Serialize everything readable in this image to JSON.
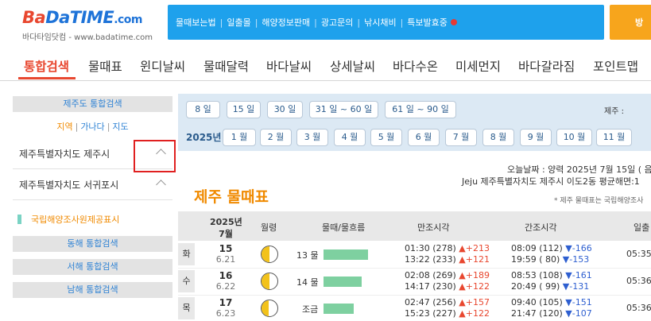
{
  "header": {
    "logo_b": "Ba",
    "logo_d": "Da",
    "logo_time": "TIME",
    "logo_com": ".com",
    "logo_sub": "바다타임닷컴 - www.badatime.com",
    "links": [
      "물때보는법",
      "일출몰",
      "해양정보판매",
      "광고문의",
      "낚시채비",
      "특보발효중"
    ],
    "right_btn": "방",
    "colors": {
      "topbar": "#1ea1ec",
      "accent": "#e8472f",
      "orange": "#f08a00"
    }
  },
  "nav": {
    "items": [
      "통합검색",
      "물때표",
      "윈디날씨",
      "물때달력",
      "바다날씨",
      "상세날씨",
      "바다수온",
      "미세먼지",
      "바다갈라짐",
      "포인트맵"
    ],
    "active": "통합검색"
  },
  "sidebar": {
    "jeju_search": "제주도 통합검색",
    "tabs": {
      "region": "지역",
      "alpha": "가나다",
      "map": "지도"
    },
    "regions": [
      "제주특별자치도 제주시",
      "제주특별자치도 서귀포시"
    ],
    "notice": "국립해양조사원제공표시",
    "east": "동해 통합검색",
    "west": "서해 통합검색",
    "south": "남해 통합검색"
  },
  "date_panel": {
    "ranges": [
      "8 일",
      "15 일",
      "30 일",
      "31 일 ~ 60 일",
      "61 일 ~ 90 일"
    ],
    "jeju_label": "제주 :",
    "year": "2025년",
    "months": [
      "1 월",
      "2 월",
      "3 월",
      "4 월",
      "5 월",
      "6 월",
      "7 월",
      "8 월",
      "9 월",
      "10 월",
      "11 월"
    ]
  },
  "info": {
    "today": "오늘날짜 : 양력 2025년 7월 15일 ( 음",
    "location": "Jeju 제주특별자치도 제주시 이도2동 평균해면:1",
    "title": "제주 물때표",
    "note": "* 제주 물때표는 국립해양조사"
  },
  "table": {
    "headers": {
      "date_year": "2025년",
      "date_month": "7월",
      "moon": "월령",
      "tide": "물때/물흐름",
      "high": "만조시각",
      "low": "간조시각",
      "sun": "일출"
    },
    "rows": [
      {
        "dow": "화",
        "date": "15",
        "lunar": "6.21",
        "moon_phase": 0.5,
        "tide_name": "13 물",
        "flow": 0.9,
        "high1": "01:30 (278)",
        "high1_chg": "▲+213",
        "high2": "13:22 (233)",
        "high2_chg": "▲+121",
        "low1": "08:09 (112)",
        "low1_chg": "▼-166",
        "low2": "19:59 ( 80)",
        "low2_chg": "▼-153",
        "sun": "05:35"
      },
      {
        "dow": "수",
        "date": "16",
        "lunar": "6.22",
        "moon_phase": 0.5,
        "tide_name": "14 물",
        "flow": 0.78,
        "high1": "02:08 (269)",
        "high1_chg": "▲+189",
        "high2": "14:17 (230)",
        "high2_chg": "▲+122",
        "low1": "08:53 (108)",
        "low1_chg": "▼-161",
        "low2": "20:49 ( 99)",
        "low2_chg": "▼-131",
        "sun": "05:36"
      },
      {
        "dow": "목",
        "date": "17",
        "lunar": "6.23",
        "moon_phase": 0.45,
        "tide_name": "조금",
        "flow": 0.62,
        "high1": "02:47 (256)",
        "high1_chg": "▲+157",
        "high2": "15:23 (227)",
        "high2_chg": "▲+122",
        "low1": "09:40 (105)",
        "low1_chg": "▼-151",
        "low2": "21:47 (120)",
        "low2_chg": "▼-107",
        "sun": "05:36"
      }
    ]
  }
}
